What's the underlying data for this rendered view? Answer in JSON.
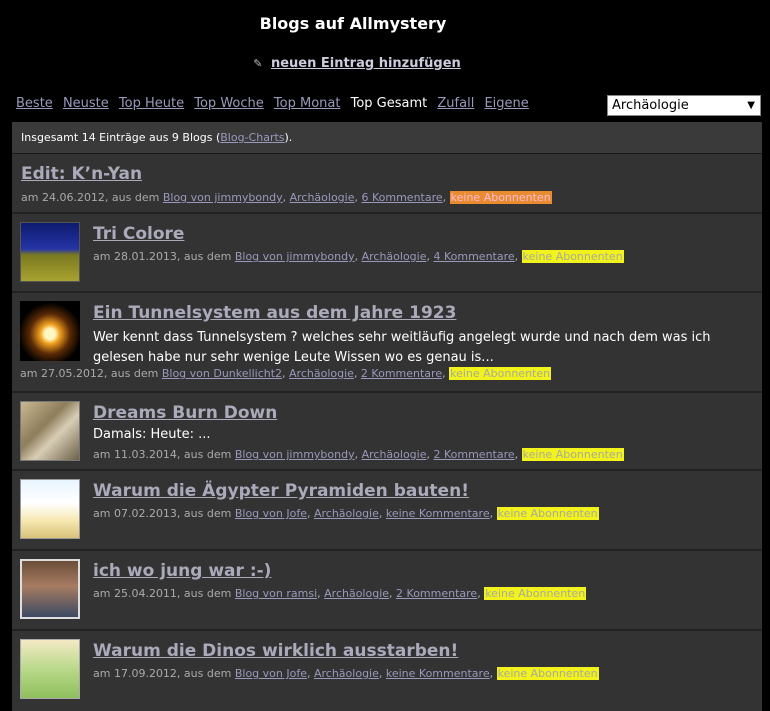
{
  "header": {
    "title": "Blogs auf Allmystery",
    "add_entry": "neuen Eintrag hinzufügen",
    "add_icon": "blog-icon"
  },
  "nav": {
    "items": [
      {
        "label": "Beste",
        "active": false
      },
      {
        "label": "Neuste",
        "active": false
      },
      {
        "label": "Top Heute",
        "active": false
      },
      {
        "label": "Top Woche",
        "active": false
      },
      {
        "label": "Top Monat",
        "active": false
      },
      {
        "label": "Top Gesamt",
        "active": true
      },
      {
        "label": "Zufall",
        "active": false
      },
      {
        "label": "Eigene",
        "active": false
      }
    ]
  },
  "category": {
    "selected": "Archäologie"
  },
  "summary": {
    "prefix": "Insgesamt 14 Einträge aus 9 Blogs (",
    "link": "Blog-Charts",
    "suffix": ")."
  },
  "entries": [
    {
      "title": "Edit: K’n-Yan",
      "date": "am 24.06.2012, aus dem",
      "blog": "Blog von jimmybondy",
      "category": "Archäologie",
      "comments": "6 Kommentare",
      "subscribers": "keine Abonnenten",
      "badge_color": "#e98b2f"
    },
    {
      "title": "Tri Colore",
      "date": "am 28.01.2013, aus dem",
      "blog": "Blog von jimmybondy",
      "category": "Archäologie",
      "comments": "4 Kommentare",
      "subscribers": "keine Abonnenten",
      "badge_color": "#f2f21c"
    },
    {
      "title": "Ein Tunnelsystem aus dem Jahre 1923",
      "excerpt": "Wer kennt dass Tunnelsystem ? welches sehr weitläufig angelegt wurde und nach dem was ich gelesen habe nur sehr wenige Leute Wissen wo es genau is...",
      "date": "am 27.05.2012, aus dem",
      "blog": "Blog von Dunkellicht2",
      "category": "Archäologie",
      "comments": "2 Kommentare",
      "subscribers": "keine Abonnenten",
      "badge_color": "#f2f21c"
    },
    {
      "title": "Dreams Burn Down",
      "excerpt": "Damals: Heute: ...",
      "date": "am 11.03.2014, aus dem",
      "blog": "Blog von jimmybondy",
      "category": "Archäologie",
      "comments": "2 Kommentare",
      "subscribers": "keine Abonnenten",
      "badge_color": "#f2f21c"
    },
    {
      "title": "Warum die Ägypter Pyramiden bauten!",
      "date": "am 07.02.2013, aus dem",
      "blog": "Blog von Jofe",
      "category": "Archäologie",
      "comments": "keine Kommentare",
      "subscribers": "keine Abonnenten",
      "badge_color": "#f2f21c"
    },
    {
      "title": "ich wo jung war :-)",
      "date": "am 25.04.2011, aus dem",
      "blog": "Blog von ramsi",
      "category": "Archäologie",
      "comments": "2 Kommentare",
      "subscribers": "keine Abonnenten",
      "badge_color": "#f2f21c"
    },
    {
      "title": "Warum die Dinos wirklich ausstarben!",
      "date": "am 17.09.2012, aus dem",
      "blog": "Blog von Jofe",
      "category": "Archäologie",
      "comments": "keine Kommentare",
      "subscribers": "keine Abonnenten",
      "badge_color": "#f2f21c"
    }
  ]
}
